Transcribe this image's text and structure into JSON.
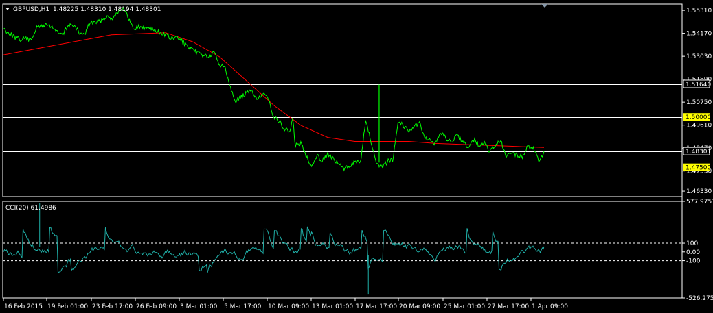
{
  "header": {
    "symbol_label": "GBPUSD,H1",
    "ohlc_values": "1.48225 1.48310 1.48194 1.48301"
  },
  "colors": {
    "background": "#000000",
    "frame": "#ffffff",
    "price": "#00ff00",
    "moving_average": "#ff0000",
    "cci": "#20b2aa",
    "level_highlight": "#ffff00"
  },
  "chart_data": [
    {
      "type": "line",
      "name": "price",
      "title": "GBPUSD,H1",
      "x_ticks": [
        "16 Feb 2015",
        "19 Feb 01:00",
        "23 Feb 17:00",
        "26 Feb 09:00",
        "3 Mar 01:00",
        "5 Mar 17:00",
        "10 Mar 09:00",
        "13 Mar 01:00",
        "17 Mar 17:00",
        "20 Mar 09:00",
        "25 Mar 01:00",
        "27 Mar 17:00",
        "1 Apr 09:00"
      ],
      "y_ticks": [
        "1.55310",
        "1.54170",
        "1.53030",
        "1.51890",
        "1.50750",
        "1.49610",
        "1.48470",
        "1.47330",
        "1.46330"
      ],
      "ylim": [
        1.4606,
        1.5562
      ],
      "price_t": [
        0,
        2,
        3,
        4,
        5,
        6,
        7,
        8,
        9,
        10,
        11,
        12,
        13,
        14,
        15,
        16,
        17,
        18,
        19,
        20,
        21,
        22,
        23,
        24,
        25,
        26,
        27,
        28,
        29,
        30,
        31,
        32,
        33,
        34,
        35,
        36,
        37,
        38,
        39,
        40,
        41,
        42,
        43,
        44,
        45,
        46,
        47,
        48,
        49,
        50,
        51,
        52,
        53,
        53.5,
        54,
        55,
        56,
        57,
        58,
        59,
        60,
        61,
        62,
        63,
        64,
        65,
        66,
        67,
        68,
        69,
        70,
        71,
        72,
        73,
        74,
        75,
        76,
        77,
        78,
        79,
        80,
        81,
        82,
        83,
        84,
        85,
        86,
        87,
        88,
        89,
        90,
        91,
        92,
        93,
        94,
        95,
        96,
        97,
        98,
        99,
        100
      ],
      "price_values": [
        1.544,
        1.54,
        1.5385,
        1.5395,
        1.538,
        1.544,
        1.5455,
        1.546,
        1.545,
        1.542,
        1.541,
        1.546,
        1.5455,
        1.542,
        1.541,
        1.547,
        1.547,
        1.548,
        1.55,
        1.549,
        1.552,
        1.5545,
        1.55,
        1.544,
        1.545,
        1.544,
        1.545,
        1.543,
        1.542,
        1.541,
        1.539,
        1.5395,
        1.538,
        1.535,
        1.533,
        1.532,
        1.531,
        1.53,
        1.532,
        1.526,
        1.525,
        1.515,
        1.508,
        1.51,
        1.512,
        1.513,
        1.509,
        1.511,
        1.51,
        1.5,
        1.498,
        1.494,
        1.493,
        1.499,
        1.486,
        1.487,
        1.481,
        1.476,
        1.481,
        1.4785,
        1.482,
        1.479,
        1.477,
        1.474,
        1.476,
        1.478,
        1.477,
        1.498,
        1.488,
        1.476,
        1.475,
        1.478,
        1.479,
        1.498,
        1.496,
        1.493,
        1.496,
        1.497,
        1.49,
        1.488,
        1.487,
        1.492,
        1.4895,
        1.488,
        1.491,
        1.488,
        1.485,
        1.489,
        1.486,
        1.487,
        1.483,
        1.486,
        1.488,
        1.48,
        1.483,
        1.481,
        1.48,
        1.486,
        1.485,
        1.478,
        1.483
      ],
      "ma_t": [
        0,
        10,
        20,
        30,
        35,
        40,
        45,
        50,
        55,
        60,
        65,
        70,
        75,
        80,
        85,
        90,
        95,
        100
      ],
      "ma_values": [
        1.531,
        1.536,
        1.541,
        1.542,
        1.5375,
        1.53,
        1.518,
        1.506,
        1.496,
        1.49,
        1.488,
        1.488,
        1.488,
        1.487,
        1.4865,
        1.486,
        1.4855,
        1.485
      ],
      "horizontal_levels": [
        {
          "value": 1.5164,
          "label": "1.51640",
          "highlight": false
        },
        {
          "value": 1.5,
          "label": "1.50000",
          "highlight": true
        },
        {
          "value": 1.48301,
          "label": "1.48301",
          "highlight": false
        },
        {
          "value": 1.475,
          "label": "1.47500",
          "highlight": true
        }
      ],
      "spike_high": 1.5162
    },
    {
      "type": "line",
      "name": "cci",
      "title": "CCI(20) 61.4986",
      "y_ticks": [
        "577.9751",
        "100",
        "0.00",
        "-100",
        "-526.2753"
      ],
      "ylim": [
        -526.2753,
        577.9751
      ],
      "levels": [
        100,
        -100
      ],
      "level_style": "dashed",
      "last_value": 61.4986
    }
  ]
}
